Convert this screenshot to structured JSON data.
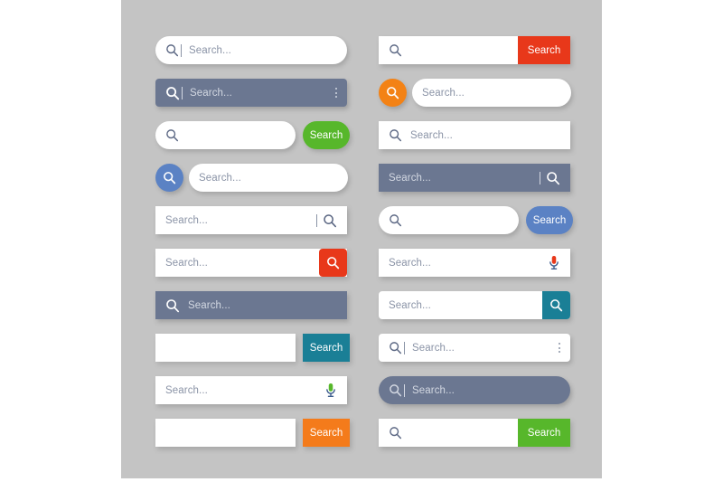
{
  "canvas": {
    "background": "#c4c4c4",
    "page_background": "#ffffff"
  },
  "palette": {
    "slate": "#6b7791",
    "placeholder_text": "#8a93a6",
    "placeholder_text_light": "#d3d8e2",
    "icon_slate": "#5b6783",
    "white": "#ffffff",
    "red": "#e8381a",
    "green": "#57b72b",
    "blue": "#5b82c4",
    "orange_button": "#f47b1b",
    "orange_circle": "#f38215",
    "teal": "#1a7f96",
    "mic_green": "#57b72b",
    "mic_red": "#e8381a",
    "mic_stand_blue": "#3a5a8c"
  },
  "common": {
    "placeholder": "Search...",
    "search_label": "Search",
    "search_icon": "magnifier-icon",
    "mic_icon": "microphone-icon",
    "menu_icon": "kebab-menu-icon",
    "divider_icon": "vertical-divider"
  },
  "left_column": [
    {
      "id": "search-bar-1",
      "style": "white-pill-icon-divider-placeholder",
      "shape": "pill",
      "field_bg": "#ffffff",
      "placeholder": "Search...",
      "icon": "magnifier-icon",
      "has_divider": true,
      "has_button": false
    },
    {
      "id": "search-bar-2",
      "style": "slate-rounded-icon-divider-placeholder-kebab",
      "shape": "rounded",
      "field_bg": "#6b7791",
      "placeholder": "Search...",
      "icon": "magnifier-icon",
      "has_divider": true,
      "has_kebab": true,
      "has_button": false
    },
    {
      "id": "search-bar-3",
      "style": "white-pill-with-green-pill-button",
      "shape": "pill",
      "field_bg": "#ffffff",
      "placeholder": "",
      "icon": "magnifier-icon",
      "has_button": true,
      "button_label": "Search",
      "button_color": "#57b72b",
      "button_shape": "pill",
      "button_detached": true
    },
    {
      "id": "search-bar-4",
      "style": "blue-circle-icon-with-white-pill",
      "shape": "pill",
      "field_bg": "#ffffff",
      "placeholder": "Search...",
      "icon": "magnifier-icon",
      "circle_color": "#5b82c4",
      "circle_side": "left",
      "has_button": false
    },
    {
      "id": "search-bar-5",
      "style": "white-square-placeholder-left-icon-right",
      "shape": "square",
      "field_bg": "#ffffff",
      "placeholder": "Search...",
      "icon": "magnifier-icon",
      "icon_side": "right",
      "has_divider": true,
      "has_button": false
    },
    {
      "id": "search-bar-6",
      "style": "white-square-with-red-rounded-icon-button",
      "shape": "square",
      "field_bg": "#ffffff",
      "placeholder": "Search...",
      "button_color": "#e8381a",
      "button_icon": "magnifier-icon",
      "button_shape": "rounded",
      "has_button": true
    },
    {
      "id": "search-bar-7",
      "style": "slate-square-icon-placeholder",
      "shape": "square",
      "field_bg": "#6b7791",
      "placeholder": "Search...",
      "icon": "magnifier-icon",
      "has_button": false
    },
    {
      "id": "search-bar-8",
      "style": "white-square-with-teal-square-button",
      "shape": "square",
      "field_bg": "#ffffff",
      "placeholder": "",
      "has_button": true,
      "button_label": "Search",
      "button_color": "#1a7f96",
      "button_shape": "square",
      "button_detached": true
    },
    {
      "id": "search-bar-9",
      "style": "white-square-placeholder-with-green-mic",
      "shape": "square",
      "field_bg": "#ffffff",
      "placeholder": "Search...",
      "mic_color": "#57b72b",
      "mic_stand_color": "#3a5a8c",
      "has_mic": true,
      "has_button": false
    },
    {
      "id": "search-bar-10",
      "style": "white-square-with-orange-square-button",
      "shape": "square",
      "field_bg": "#ffffff",
      "placeholder": "",
      "has_button": true,
      "button_label": "Search",
      "button_color": "#f47b1b",
      "button_shape": "square",
      "button_detached": true
    }
  ],
  "right_column": [
    {
      "id": "search-bar-11",
      "style": "white-square-icon-with-red-attached-button",
      "shape": "square",
      "field_bg": "#ffffff",
      "placeholder": "",
      "icon": "magnifier-icon",
      "has_button": true,
      "button_label": "Search",
      "button_color": "#e8381a",
      "button_shape": "square",
      "button_detached": false
    },
    {
      "id": "search-bar-12",
      "style": "orange-circle-icon-with-white-pill",
      "shape": "pill",
      "field_bg": "#ffffff",
      "placeholder": "Search...",
      "icon": "magnifier-icon",
      "circle_color": "#f38215",
      "circle_side": "left",
      "has_button": false
    },
    {
      "id": "search-bar-13",
      "style": "white-square-icon-placeholder",
      "shape": "square",
      "field_bg": "#ffffff",
      "placeholder": "Search...",
      "icon": "magnifier-icon",
      "has_button": false
    },
    {
      "id": "search-bar-14",
      "style": "slate-square-placeholder-divider-icon-right",
      "shape": "square",
      "field_bg": "#6b7791",
      "placeholder": "Search...",
      "icon": "magnifier-icon",
      "icon_side": "right",
      "has_divider": true,
      "has_button": false
    },
    {
      "id": "search-bar-15",
      "style": "white-pill-icon-with-blue-pill-button",
      "shape": "pill",
      "field_bg": "#ffffff",
      "placeholder": "",
      "icon": "magnifier-icon",
      "has_button": true,
      "button_label": "Search",
      "button_color": "#5b82c4",
      "button_shape": "pill",
      "button_detached": true
    },
    {
      "id": "search-bar-16",
      "style": "white-square-placeholder-with-red-mic",
      "shape": "square",
      "field_bg": "#ffffff",
      "placeholder": "Search...",
      "mic_color": "#e8381a",
      "mic_stand_color": "#3a5a8c",
      "has_mic": true,
      "has_button": false
    },
    {
      "id": "search-bar-17",
      "style": "white-rounded-with-teal-icon-button",
      "shape": "rounded",
      "field_bg": "#ffffff",
      "placeholder": "Search...",
      "button_color": "#1a7f96",
      "button_icon": "magnifier-icon",
      "button_shape": "rounded",
      "has_button": true
    },
    {
      "id": "search-bar-18",
      "style": "white-rounded-icon-divider-placeholder-kebab",
      "shape": "rounded",
      "field_bg": "#ffffff",
      "placeholder": "Search...",
      "icon": "magnifier-icon",
      "has_divider": true,
      "has_kebab": true,
      "has_button": false
    },
    {
      "id": "search-bar-19",
      "style": "slate-pill-icon-divider-placeholder",
      "shape": "pill",
      "field_bg": "#6b7791",
      "placeholder": "Search...",
      "icon": "magnifier-icon",
      "has_divider": true,
      "has_button": false
    },
    {
      "id": "search-bar-20",
      "style": "white-square-icon-with-green-attached-button",
      "shape": "square",
      "field_bg": "#ffffff",
      "placeholder": "",
      "icon": "magnifier-icon",
      "has_button": true,
      "button_label": "Search",
      "button_color": "#57b72b",
      "button_shape": "square",
      "button_detached": false
    }
  ]
}
